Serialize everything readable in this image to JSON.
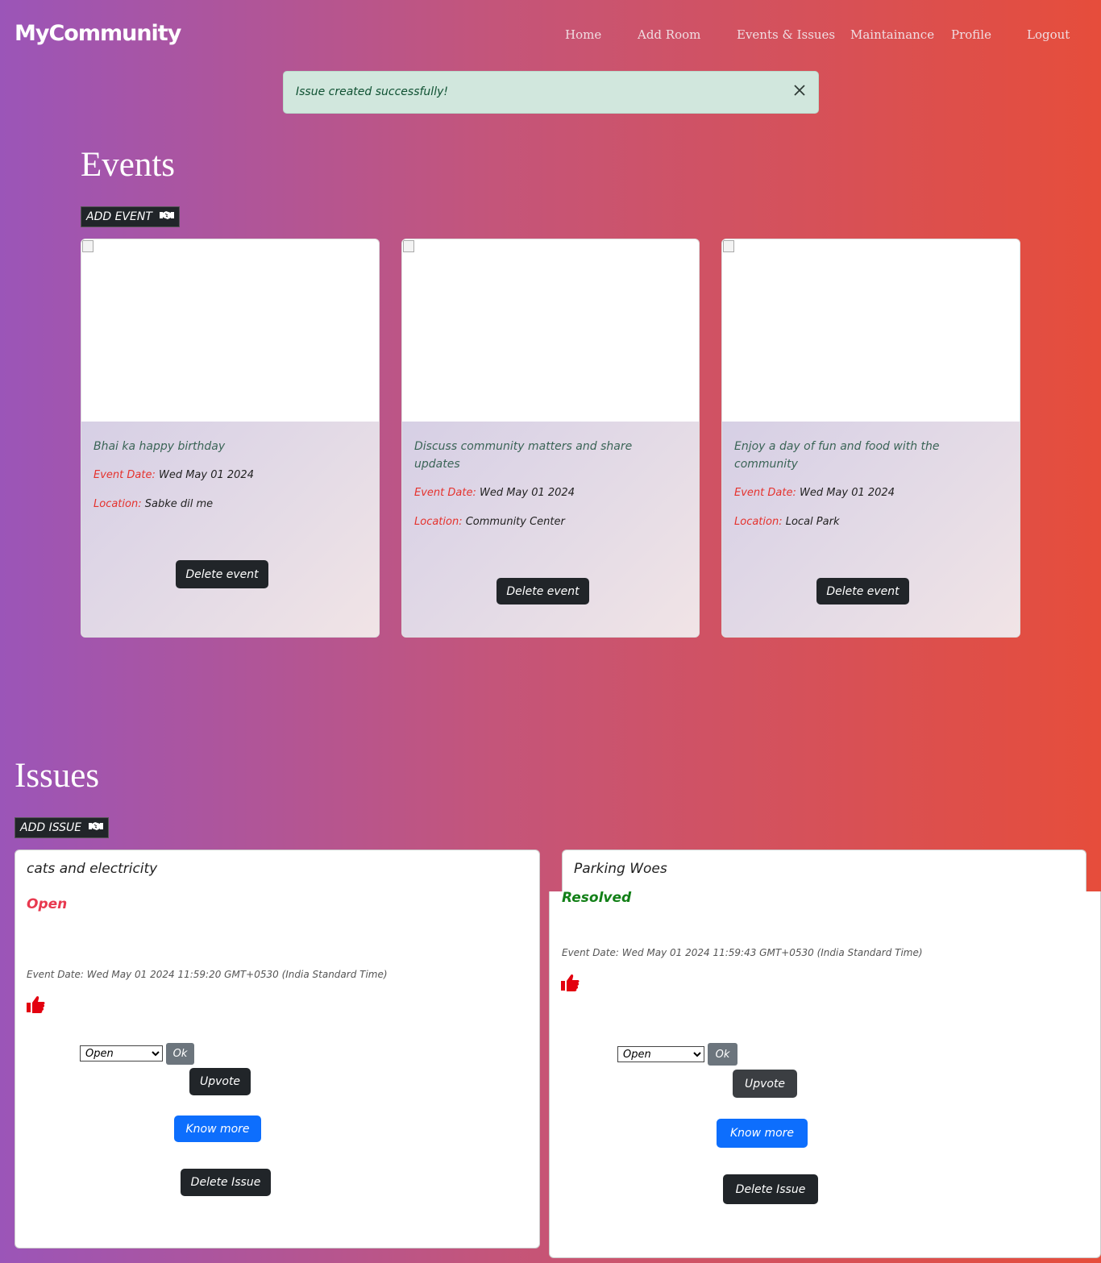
{
  "brand": "MyCommunity",
  "nav": {
    "home": "Home",
    "add_room": "Add Room",
    "events_issues": "Events & Issues",
    "maintenance": "Maintainance",
    "profile": "Profile",
    "logout": "Logout"
  },
  "alert": {
    "message": "Issue created successfully!",
    "close_icon": "close-icon"
  },
  "events": {
    "heading": "Events",
    "add_label": "ADD EVENT",
    "add_icon": "handshake-icon",
    "date_label": "Event Date:",
    "location_label": "Location:",
    "delete_label": "Delete event",
    "items": [
      {
        "description": "Bhai ka happy birthday",
        "date": "Wed May 01 2024",
        "location": "Sabke dil me"
      },
      {
        "description": "Discuss community matters and share updates",
        "date": "Wed May 01 2024",
        "location": "Community Center"
      },
      {
        "description": "Enjoy a day of fun and food with the community",
        "date": "Wed May 01 2024",
        "location": "Local Park"
      }
    ]
  },
  "issues": {
    "heading": "Issues",
    "add_label": "ADD ISSUE",
    "add_icon": "handshake-icon",
    "thumb_icon": "thumbs-up-icon",
    "ok_label": "Ok",
    "upvote_label": "Upvote",
    "know_more_label": "Know more",
    "delete_label": "Delete Issue",
    "items": [
      {
        "title": "cats and electricity",
        "status": "Open",
        "status_color": "#e8394f",
        "date": "Event Date: Wed May 01 2024 11:59:20 GMT+0530 (India Standard Time)",
        "select_value": "Open"
      },
      {
        "title": "Parking Woes",
        "status": "Resolved",
        "status_color": "#138018",
        "date": "Event Date: Wed May 01 2024 11:59:43 GMT+0530 (India Standard Time)",
        "select_value": "Open"
      }
    ]
  },
  "colors": {
    "primary_button": "#0d6efd",
    "dark_button": "#212529",
    "ok_button": "#6c757d",
    "alert_bg": "#d1e7dd",
    "label_red": "#e5322d"
  }
}
